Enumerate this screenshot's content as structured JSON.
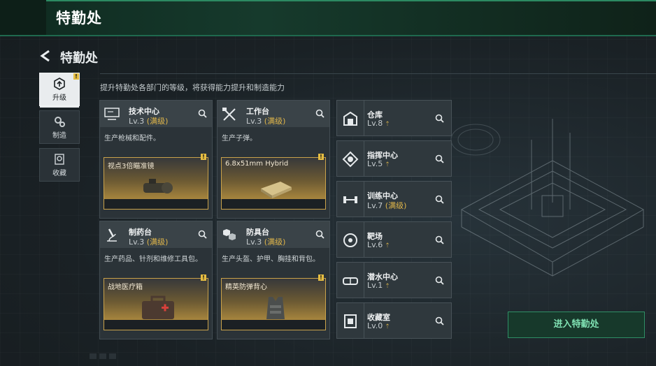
{
  "header": {
    "title": "特勤处"
  },
  "page": {
    "title": "特勤处",
    "description": "提升特勤处各部门的等级，将获得能力提升和制造能力"
  },
  "tabs": [
    {
      "label": "升级",
      "icon": "upgrade-icon",
      "active": true,
      "badge": "!"
    },
    {
      "label": "制造",
      "icon": "gears-icon",
      "active": false
    },
    {
      "label": "收藏",
      "icon": "collection-icon",
      "active": false
    }
  ],
  "cards": [
    {
      "name": "技术中心",
      "level": "Lv.3",
      "status": "(满级)",
      "desc": "生产枪械和配件。",
      "product": "视点3倍瞄准镜",
      "icon": "computer-icon",
      "badge": "!"
    },
    {
      "name": "工作台",
      "level": "Lv.3",
      "status": "(满级)",
      "desc": "生产子弹。",
      "product": "6.8x51mm Hybrid",
      "icon": "tools-icon",
      "badge": "!"
    },
    {
      "name": "制药台",
      "level": "Lv.3",
      "status": "(满级)",
      "desc": "生产药品、针剂和维修工具包。",
      "product": "战地医疗箱",
      "icon": "microscope-icon",
      "badge": "!"
    },
    {
      "name": "防具台",
      "level": "Lv.3",
      "status": "(满级)",
      "desc": "生产头盔、护甲、胸挂和背包。",
      "product": "精英防弹背心",
      "icon": "armor-parts-icon",
      "badge": "!"
    }
  ],
  "facilities": [
    {
      "name": "仓库",
      "level": "Lv.8",
      "status": "",
      "icon": "warehouse-icon"
    },
    {
      "name": "指挥中心",
      "level": "Lv.5",
      "status": "",
      "icon": "command-center-icon"
    },
    {
      "name": "训练中心",
      "level": "Lv.7",
      "status": "(满级)",
      "icon": "dumbbell-icon"
    },
    {
      "name": "靶场",
      "level": "Lv.6",
      "status": "",
      "icon": "target-icon"
    },
    {
      "name": "潜水中心",
      "level": "Lv.1",
      "status": "",
      "icon": "diving-mask-icon"
    },
    {
      "name": "收藏室",
      "level": "Lv.0",
      "status": "",
      "icon": "display-case-icon"
    }
  ],
  "enter_button": {
    "label": "进入特勤处"
  },
  "colors": {
    "accent_green": "#2f8f66",
    "max_level_gold": "#e0b64a",
    "badge_yellow": "#e5bd42"
  }
}
